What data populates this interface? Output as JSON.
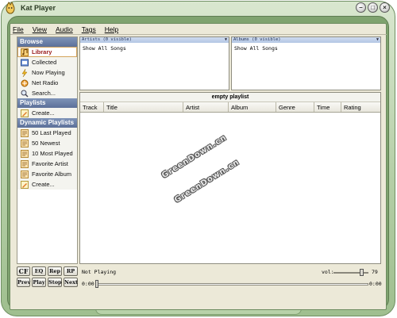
{
  "window": {
    "title": "Kat Player"
  },
  "menu": [
    {
      "label": "File"
    },
    {
      "label": "View"
    },
    {
      "label": "Audio"
    },
    {
      "label": "Tags"
    },
    {
      "label": "Help"
    }
  ],
  "sidebar": {
    "browse": {
      "header": "Browse",
      "items": [
        {
          "label": "Library",
          "icon": "music-note-icon"
        },
        {
          "label": "Collected",
          "icon": "collection-icon"
        },
        {
          "label": "Now Playing",
          "icon": "lightning-icon"
        },
        {
          "label": "Net Radio",
          "icon": "radio-icon"
        },
        {
          "label": "Search...",
          "icon": "search-icon"
        }
      ]
    },
    "playlists": {
      "header": "Playlists",
      "items": [
        {
          "label": "Create...",
          "icon": "pencil-icon"
        }
      ]
    },
    "dynamic": {
      "header": "Dynamic Playlists",
      "items": [
        {
          "label": "50 Last Played",
          "icon": "playlist-icon"
        },
        {
          "label": "50 Newest",
          "icon": "playlist-icon"
        },
        {
          "label": "10 Most Played",
          "icon": "playlist-icon"
        },
        {
          "label": "Favorite Artist",
          "icon": "playlist-icon"
        },
        {
          "label": "Favorite Album",
          "icon": "playlist-icon"
        },
        {
          "label": "Create...",
          "icon": "pencil-icon"
        }
      ]
    }
  },
  "artists_pane": {
    "header": "Artists (0 visible)",
    "row": "Show All Songs"
  },
  "albums_pane": {
    "header": "Albums (0 visible)",
    "row": "Show All Songs"
  },
  "playlist": {
    "title": "empty playlist",
    "columns": [
      "Track",
      "Title",
      "Artist",
      "Album",
      "Genre",
      "Time",
      "Rating"
    ]
  },
  "watermark": "GreenDown.cn",
  "controls": {
    "cf": "CF",
    "eq": "EQ",
    "rep": "Rep",
    "rp": "RP",
    "prev": "Prev",
    "play": "Play",
    "stop": "Stop",
    "next": "Next"
  },
  "status": "Not Playing",
  "volume": {
    "label": "vol:",
    "value": "79"
  },
  "time": {
    "elapsed": "0:00",
    "total": "0:00"
  }
}
